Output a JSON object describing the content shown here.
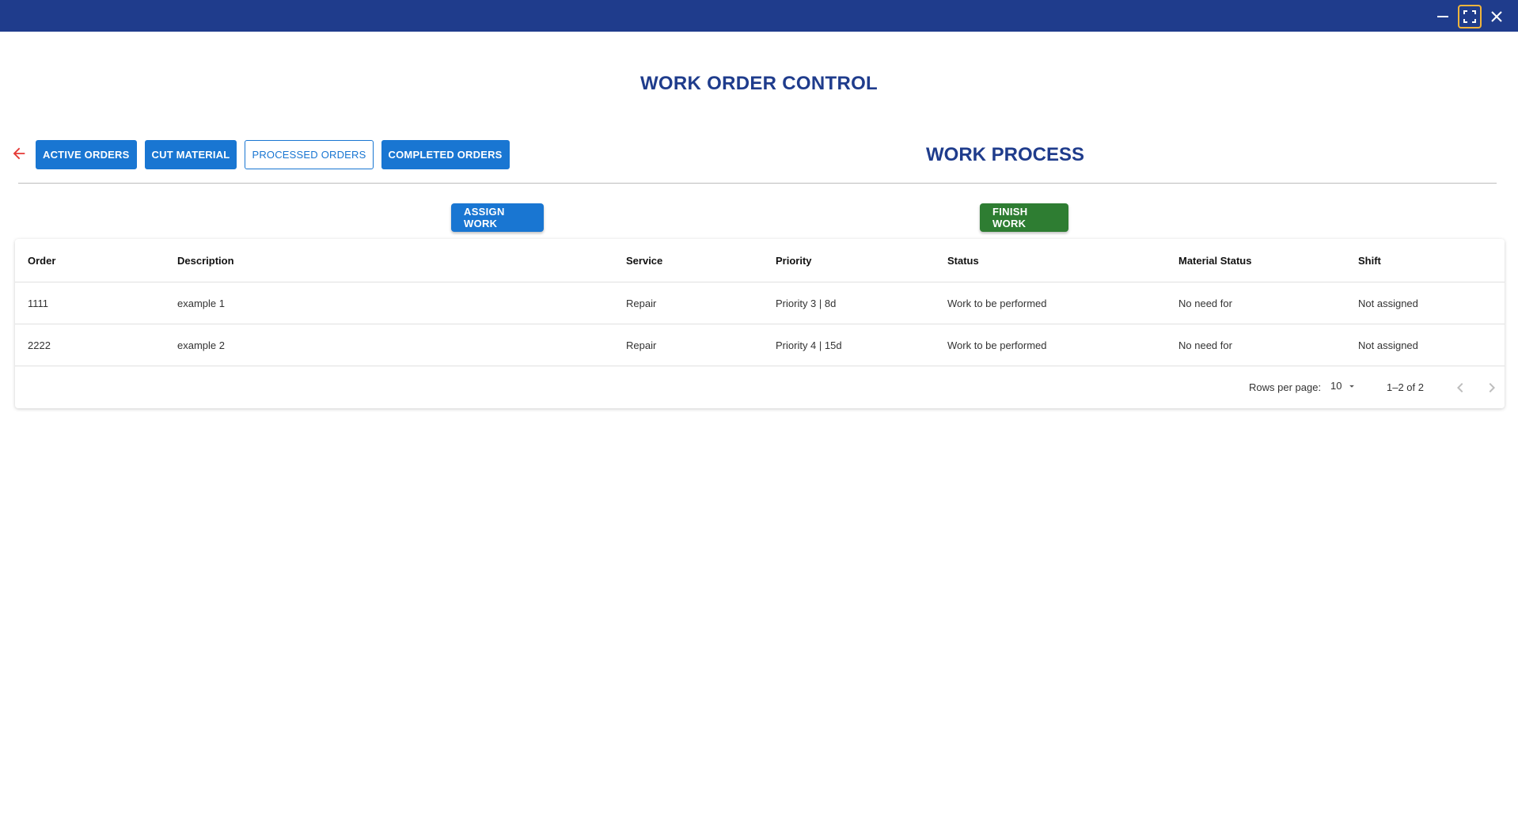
{
  "window": {
    "titlebar_color": "#1f3c8c",
    "controls": [
      "minimize-icon",
      "fullscreen-icon",
      "close-icon"
    ]
  },
  "app_title": "WORK ORDER CONTROL",
  "tabs": [
    {
      "label": "ACTIVE ORDERS",
      "selected": false
    },
    {
      "label": "CUT MATERIAL",
      "selected": false
    },
    {
      "label": "PROCESSED ORDERS",
      "selected": true
    },
    {
      "label": "COMPLETED ORDERS",
      "selected": false
    }
  ],
  "section_title": "WORK PROCESS",
  "actions": {
    "assign_label": "ASSIGN WORK",
    "finish_label": "FINISH WORK"
  },
  "table": {
    "headers": [
      "Order",
      "Description",
      "Service",
      "Priority",
      "Status",
      "Material Status",
      "Shift"
    ],
    "rows": [
      [
        "1111",
        "example 1",
        "Repair",
        "Priority 3 | 8d",
        "Work to be performed",
        "No need for",
        "Not assigned"
      ],
      [
        "2222",
        "example 2",
        "Repair",
        "Priority 4 | 15d",
        "Work to be performed",
        "No need for",
        "Not assigned"
      ]
    ]
  },
  "pagination": {
    "rows_per_page_label": "Rows per page:",
    "rows_per_page_value": "10",
    "range": "1–2 of 2"
  },
  "colors": {
    "primary_blue": "#1976d2",
    "title_navy": "#1f3c8c",
    "success_green": "#2e7d32",
    "back_arrow_red": "#e53935"
  }
}
